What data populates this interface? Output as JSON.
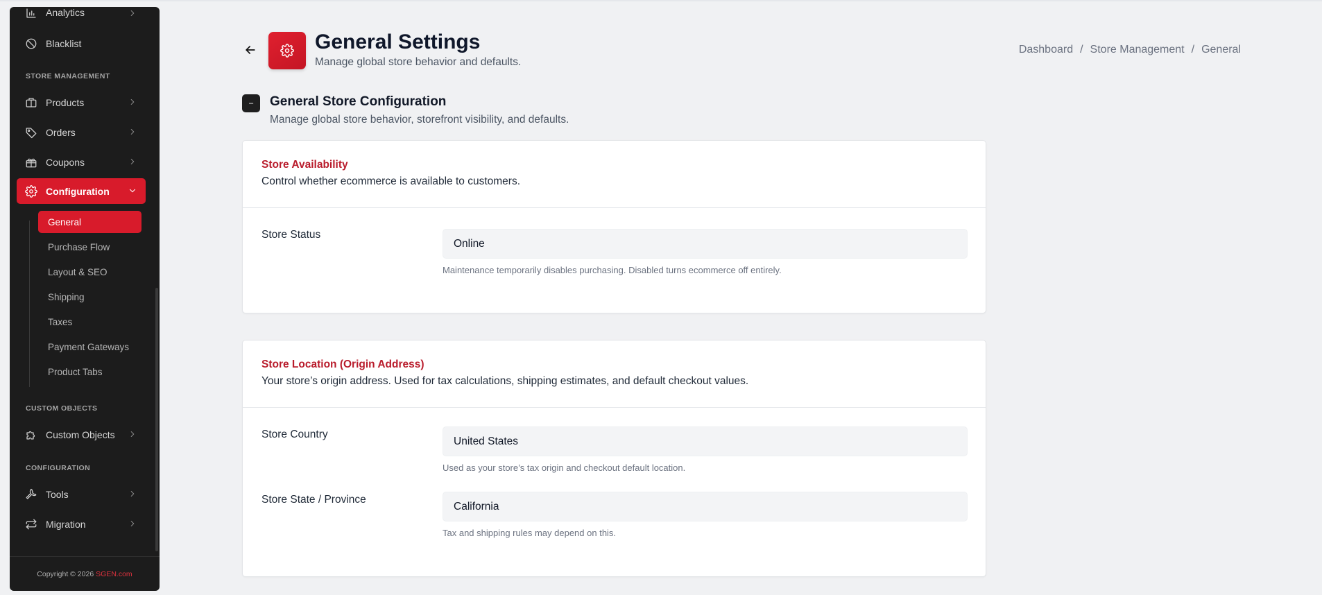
{
  "sidebar": {
    "items": [
      {
        "label": "Analytics"
      },
      {
        "label": "Blacklist"
      },
      {
        "label": "Products"
      },
      {
        "label": "Orders"
      },
      {
        "label": "Coupons"
      },
      {
        "label": "Configuration"
      },
      {
        "label": "Custom Objects"
      },
      {
        "label": "Tools"
      },
      {
        "label": "Migration"
      }
    ],
    "sections": [
      "STORE MANAGEMENT",
      "CUSTOM OBJECTS",
      "CONFIGURATION"
    ],
    "sub_items": [
      "General",
      "Purchase Flow",
      "Layout & SEO",
      "Shipping",
      "Taxes",
      "Payment Gateways",
      "Product Tabs"
    ],
    "footer": {
      "text": "Copyright © 2026",
      "brand": "SGEN.com"
    }
  },
  "header": {
    "title": "General Settings",
    "subtitle": "Manage global store behavior and defaults.",
    "breadcrumb": [
      "Dashboard",
      "Store Management",
      "General"
    ],
    "separator": "/"
  },
  "section": {
    "badge": "–",
    "title": "General Store Configuration",
    "subtitle": "Manage global store behavior, storefront visibility, and defaults."
  },
  "availability_card": {
    "title": "Store Availability",
    "description": "Control whether ecommerce is available to customers.",
    "fields": [
      {
        "label": "Store Status",
        "value": "Online",
        "help": "Maintenance temporarily disables purchasing. Disabled turns ecommerce off entirely."
      }
    ]
  },
  "location_card": {
    "title": "Store Location (Origin Address)",
    "description": "Your store’s origin address. Used for tax calculations, shipping estimates, and default checkout values.",
    "fields": [
      {
        "label": "Store Country",
        "value": "United States",
        "help": "Used as your store’s tax origin and checkout default location."
      },
      {
        "label": "Store State / Province",
        "value": "California",
        "help": "Tax and shipping rules may depend on this."
      }
    ]
  },
  "colors": {
    "accent": "#d81b2b",
    "sidebar_bg": "#1c1c1c",
    "card_title": "#b91c2c"
  }
}
